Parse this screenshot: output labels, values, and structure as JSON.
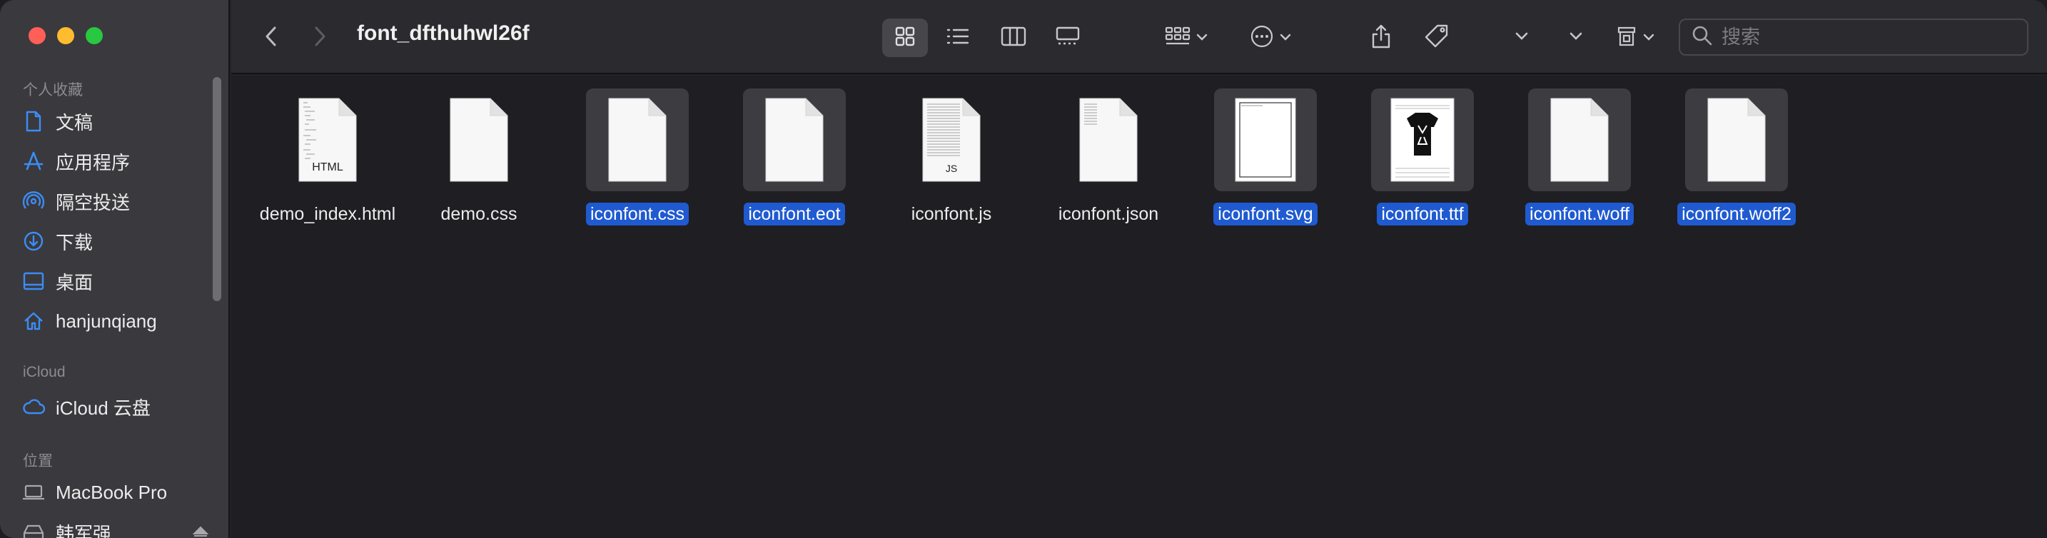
{
  "window": {
    "title": "font_dfthuhwl26f"
  },
  "sidebar": {
    "sections": {
      "favorites": "个人收藏",
      "icloud": "iCloud",
      "locations": "位置"
    },
    "favorites": [
      {
        "label": "文稿",
        "icon": "document-icon"
      },
      {
        "label": "应用程序",
        "icon": "applications-icon"
      },
      {
        "label": "隔空投送",
        "icon": "airdrop-icon"
      },
      {
        "label": "下载",
        "icon": "download-icon"
      },
      {
        "label": "桌面",
        "icon": "desktop-icon"
      },
      {
        "label": "hanjunqiang",
        "icon": "home-icon"
      }
    ],
    "icloud": [
      {
        "label": "iCloud 云盘",
        "icon": "cloud-icon"
      }
    ],
    "locations": [
      {
        "label": "MacBook Pro",
        "icon": "laptop-icon"
      },
      {
        "label": "韩军强",
        "icon": "disk-icon"
      }
    ]
  },
  "search": {
    "placeholder": "搜索"
  },
  "files": [
    {
      "name": "demo_index.html",
      "selected": false,
      "kind": "html",
      "badge": "HTML"
    },
    {
      "name": "demo.css",
      "selected": false,
      "kind": "blank",
      "badge": ""
    },
    {
      "name": "iconfont.css",
      "selected": true,
      "kind": "blank",
      "badge": ""
    },
    {
      "name": "iconfont.eot",
      "selected": true,
      "kind": "blank",
      "badge": ""
    },
    {
      "name": "iconfont.js",
      "selected": false,
      "kind": "js",
      "badge": "JS"
    },
    {
      "name": "iconfont.json",
      "selected": false,
      "kind": "text",
      "badge": ""
    },
    {
      "name": "iconfont.svg",
      "selected": true,
      "kind": "svg",
      "badge": ""
    },
    {
      "name": "iconfont.ttf",
      "selected": true,
      "kind": "font",
      "badge": ""
    },
    {
      "name": "iconfont.woff",
      "selected": true,
      "kind": "blank",
      "badge": ""
    },
    {
      "name": "iconfont.woff2",
      "selected": true,
      "kind": "blank",
      "badge": ""
    }
  ],
  "colors": {
    "selection": "#1f5ad0",
    "accent": "#3b8df5",
    "close": "#ff5f57",
    "minimize": "#febc2e",
    "maximize": "#28c840"
  }
}
